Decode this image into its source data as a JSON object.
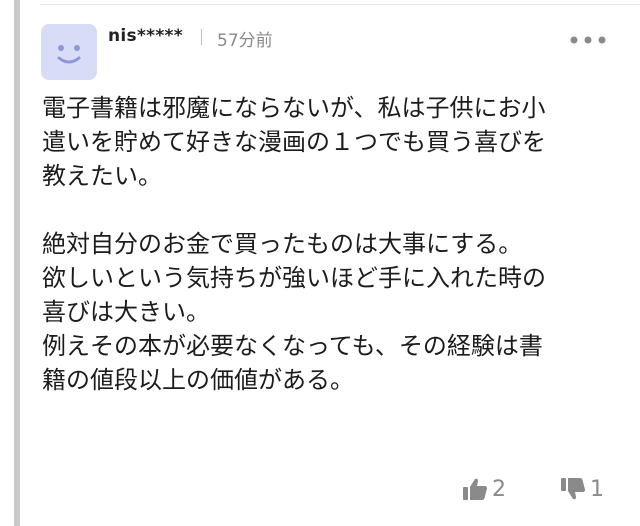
{
  "comment": {
    "username": "nis*****",
    "time": "57分前",
    "lines": [
      "電子書籍は邪魔にならないが、私は子供にお小",
      "遣いを貯めて好きな漫画の１つでも買う喜びを",
      "教えたい。",
      "",
      "絶対自分のお金で買ったものは大事にする。",
      "欲しいという気持ちが強いほど手に入れた時の",
      "喜びは大きい。",
      "例えその本が必要なくなっても、その経験は書",
      "籍の値段以上の価値がある。"
    ],
    "likes": "2",
    "dislikes": "1"
  },
  "icons": {
    "avatar": "smiley-face-icon",
    "more": "more-dots-icon",
    "like": "thumbs-up-icon",
    "dislike": "thumbs-down-icon"
  },
  "colors": {
    "avatar_bg": "#d9dcf7",
    "avatar_face": "#8f96d6",
    "muted": "#8a8a8a"
  }
}
